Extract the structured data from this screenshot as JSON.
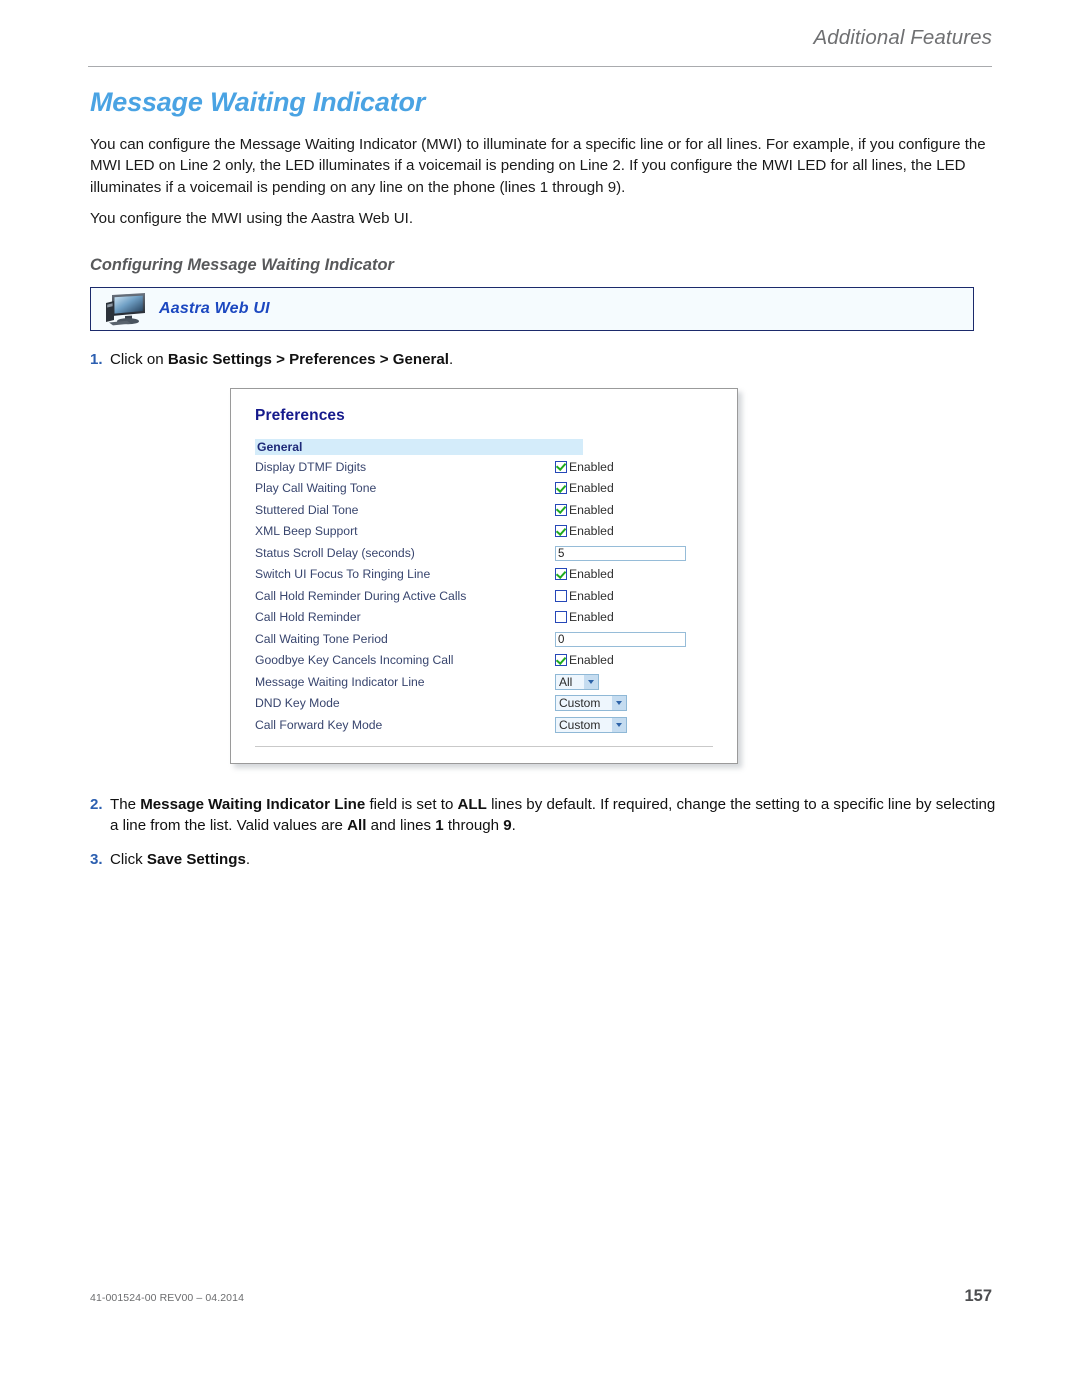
{
  "header": {
    "running_title": "Additional Features"
  },
  "title": "Message Waiting Indicator",
  "paragraphs": [
    "You can configure the Message Waiting Indicator (MWI) to illuminate for a specific line or for all lines. For example, if you configure the MWI LED on Line 2 only, the LED illuminates if a voicemail is pending on Line 2. If you configure the MWI LED for all lines, the LED illuminates if a voicemail is pending on any line on the phone (lines 1 through 9).",
    "You configure the MWI using the Aastra Web UI."
  ],
  "subtitle": "Configuring Message Waiting Indicator",
  "callout": {
    "icon": "monitor-icon",
    "label": "Aastra Web UI"
  },
  "steps": {
    "one": {
      "num": "1.",
      "prefix": "Click on ",
      "bold": "Basic Settings > Preferences > General",
      "suffix": "."
    },
    "two": {
      "num": "2.",
      "p1": "The ",
      "b1": "Message Waiting Indicator Line",
      "p2": " field is set to ",
      "b2": "ALL",
      "p3": " lines by default. If required, change the setting to a specific line by selecting a line from the list. Valid values are ",
      "b3": "All",
      "p4": " and lines ",
      "b4": "1",
      "p5": " through ",
      "b5": "9",
      "p6": "."
    },
    "three": {
      "num": "3.",
      "prefix": "Click ",
      "bold": "Save Settings",
      "suffix": "."
    }
  },
  "screenshot": {
    "title": "Preferences",
    "section": "General",
    "rows": [
      {
        "label": "Display DTMF Digits",
        "control": "checkbox",
        "checked": true,
        "text": "Enabled"
      },
      {
        "label": "Play Call Waiting Tone",
        "control": "checkbox",
        "checked": true,
        "text": "Enabled"
      },
      {
        "label": "Stuttered Dial Tone",
        "control": "checkbox",
        "checked": true,
        "text": "Enabled"
      },
      {
        "label": "XML Beep Support",
        "control": "checkbox",
        "checked": true,
        "text": "Enabled"
      },
      {
        "label": "Status Scroll Delay (seconds)",
        "control": "input",
        "value": "5"
      },
      {
        "label": "Switch UI Focus To Ringing Line",
        "control": "checkbox",
        "checked": true,
        "text": "Enabled"
      },
      {
        "label": "Call Hold Reminder During Active Calls",
        "control": "checkbox",
        "checked": false,
        "text": "Enabled"
      },
      {
        "label": "Call Hold Reminder",
        "control": "checkbox",
        "checked": false,
        "text": "Enabled"
      },
      {
        "label": "Call Waiting Tone Period",
        "control": "input",
        "value": "0"
      },
      {
        "label": "Goodbye Key Cancels Incoming Call",
        "control": "checkbox",
        "checked": true,
        "text": "Enabled"
      },
      {
        "label": "Message Waiting Indicator Line",
        "control": "select",
        "value": "All",
        "width": "w-all"
      },
      {
        "label": "DND Key Mode",
        "control": "select",
        "value": "Custom",
        "width": "w-custom"
      },
      {
        "label": "Call Forward Key Mode",
        "control": "select",
        "value": "Custom",
        "width": "w-custom"
      }
    ]
  },
  "footer": {
    "doc_number": "41-001524-00 REV00 – 04.2014",
    "page_number": "157"
  },
  "colors": {
    "title_blue": "#4aa3e3",
    "step_number_blue": "#2c5fb0",
    "callout_blue": "#1c48c0",
    "section_bar": "#d4ecfa"
  }
}
